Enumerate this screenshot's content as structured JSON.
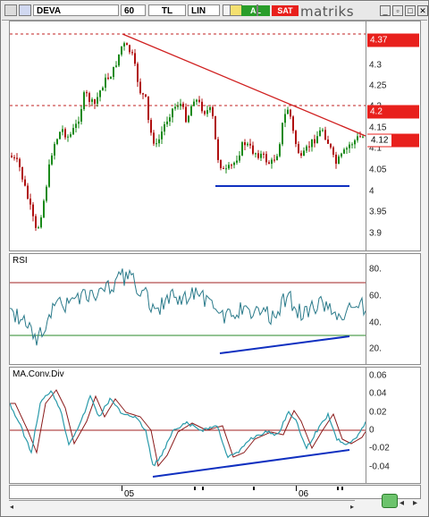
{
  "toolbar": {
    "symbol": "DEVA",
    "period": "60",
    "currency": "TL",
    "scale": "LIN",
    "buy_label": "AL",
    "sell_label": "SAT",
    "logo": "matriks",
    "colors": {
      "buy": "#2a9d2a",
      "sell": "#e8201c"
    }
  },
  "price_axis": {
    "ticks": [
      "4.3",
      "4.25",
      "4.2",
      "4.15",
      "4.1",
      "4.05",
      "4",
      "3.95",
      "3.9"
    ],
    "labels": [
      "4.37",
      "4.2",
      "4.12"
    ]
  },
  "rsi": {
    "title": "RSI",
    "ticks": [
      "80.",
      "60.",
      "40.",
      "20."
    ]
  },
  "macd": {
    "title": "MA.Conv.Div",
    "ticks": [
      "0.06",
      "0.04",
      "0.02",
      "0",
      "-0.02",
      "-0.04"
    ]
  },
  "time_axis": {
    "labels": [
      "05",
      "06"
    ]
  },
  "colors": {
    "up_candle": "#1a8a1a",
    "down_candle": "#b01010",
    "trendline": "#d02020",
    "support": "#1030c0",
    "rsi_line": "#2a7a8a",
    "macd_line": "#2a9aaa",
    "signal_line": "#8a1a1a"
  }
}
